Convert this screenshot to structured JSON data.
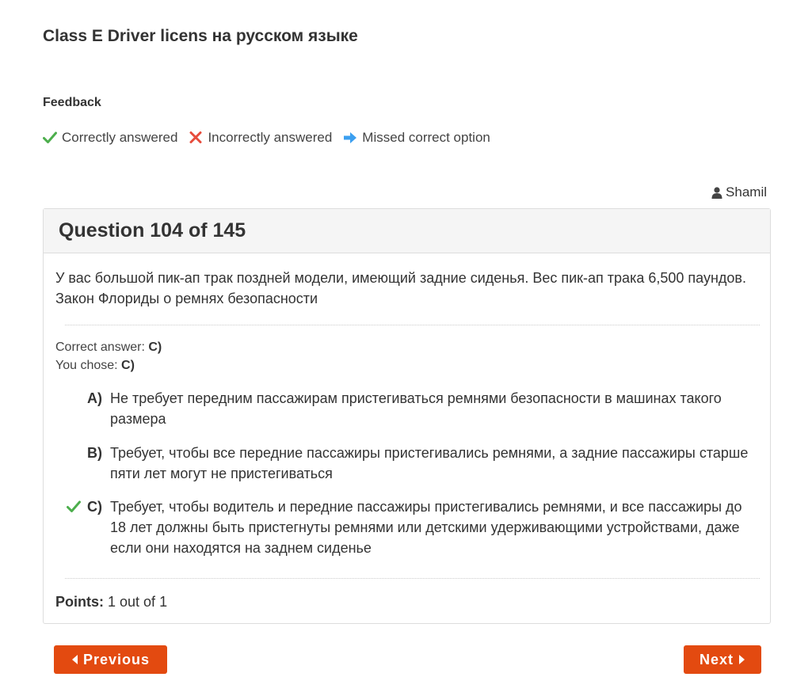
{
  "page": {
    "title": "Class E Driver licens на русском языке"
  },
  "feedback": {
    "heading": "Feedback",
    "legend": [
      {
        "icon": "check-icon",
        "label": "Correctly answered",
        "color": "#4cae4c"
      },
      {
        "icon": "cross-icon",
        "label": "Incorrectly answered",
        "color": "#e74c3c"
      },
      {
        "icon": "arrow-right-icon",
        "label": "Missed correct option",
        "color": "#3b9ff0"
      }
    ]
  },
  "user": {
    "icon": "user-icon",
    "name": "Shamil"
  },
  "question": {
    "header": "Question 104 of 145",
    "text": "У вас большой пик-ап трак поздней модели, имеющий задние сиденья. Вес пик-ап трака 6,500 паундов. Закон Флориды о ремнях безопасности",
    "correct_label": "Correct answer:",
    "correct_value": "C)",
    "chose_label": "You chose:",
    "chose_value": "C)",
    "options": [
      {
        "letter": "A)",
        "text": "Не требует передним пассажирам пристегиваться ремнями безопасности в машинах такого размера",
        "mark": ""
      },
      {
        "letter": "B)",
        "text": "Требует, чтобы все передние пассажиры пристегивались ремнями, а задние пассажиры старше пяти лет могут не пристегиваться",
        "mark": ""
      },
      {
        "letter": "C)",
        "text": "Требует, чтобы водитель и передние пассажиры пристегивались ремнями, и все пассажиры до 18 лет должны быть пристегнуты ремнями или детскими удерживающими устройствами, даже если они находятся на заднем сиденье",
        "mark": "check-icon"
      }
    ],
    "points_label": "Points:",
    "points_value": "1 out of 1"
  },
  "nav": {
    "previous_label": "Previous",
    "next_label": "Next"
  },
  "colors": {
    "accent": "#e34a10",
    "correct": "#4cae4c",
    "incorrect": "#e74c3c",
    "missed": "#3b9ff0"
  }
}
